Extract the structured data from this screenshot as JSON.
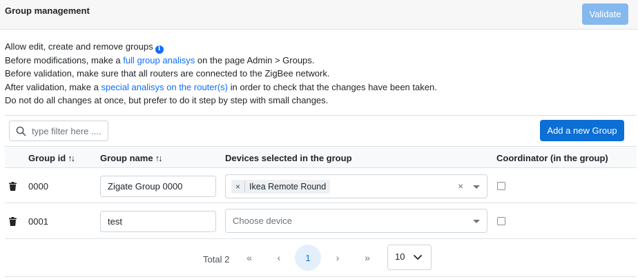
{
  "header": {
    "title": "Group management",
    "validate_label": "Validate"
  },
  "info": {
    "line1": "Allow edit, create and remove groups",
    "line2_pre": "Before modifications, make a ",
    "line2_link": "full group analisys",
    "line2_post": " on the page Admin > Groups.",
    "line3": "Before validation, make sure that all routers are connected to the ZigBee network.",
    "line4_pre": "After validation, make a ",
    "line4_link": "special analisys on the router(s)",
    "line4_post": " in order to check that the changes have been taken.",
    "line5": "Do not do all changes at once, but prefer to do it step by step with small changes."
  },
  "toolbar": {
    "search_placeholder": "type filter here ....",
    "add_label": "Add a new Group"
  },
  "table": {
    "headers": {
      "group_id": "Group id",
      "group_name": "Group name",
      "devices": "Devices selected in the group",
      "coordinator": "Coordinator (in the group)",
      "sort_symbol": "↑↓"
    },
    "rows": [
      {
        "id": "0000",
        "name": "Zigate Group 0000",
        "device_tag": "Ikea Remote Round",
        "device_placeholder": "",
        "coordinator_checked": false
      },
      {
        "id": "0001",
        "name": "test",
        "device_tag": "",
        "device_placeholder": "Choose device",
        "coordinator_checked": false
      }
    ]
  },
  "pagination": {
    "total_label": "Total 2",
    "first": "«",
    "prev": "‹",
    "current_page": "1",
    "next": "›",
    "last": "»",
    "per_page": "10"
  },
  "colors": {
    "accent": "#0b6fd6",
    "validate_disabled": "#85b9ee",
    "link": "#0d6efd"
  }
}
